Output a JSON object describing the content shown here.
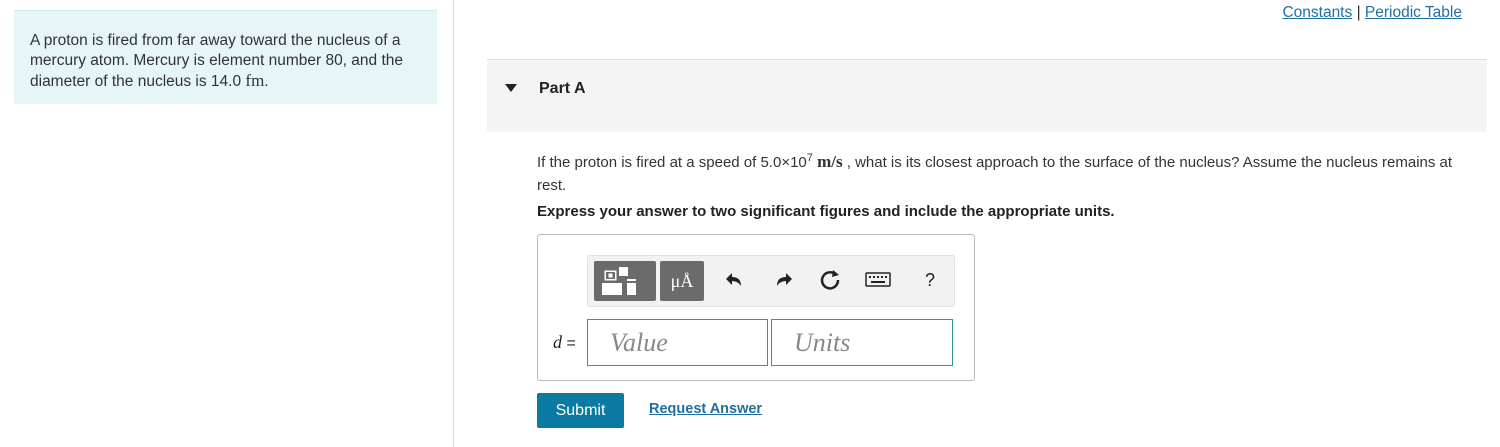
{
  "problem": {
    "text_before": "A proton is fired from far away toward the nucleus of a mercury atom. Mercury is element number 80, and the diameter of the nucleus is 14.0 ",
    "unit": "fm",
    "text_after": "."
  },
  "top_links": {
    "constants": "Constants",
    "separator": "|",
    "periodic_table": "Periodic Table"
  },
  "part": {
    "title": "Part A"
  },
  "question": {
    "prefix": "If the proton is fired at a speed of 5.0×10",
    "exponent": "7",
    "unit": "m/s",
    "suffix": ", what is its closest approach to the surface of the nucleus? Assume the nucleus remains at rest."
  },
  "instruction": "Express your answer to two significant figures and include the appropriate units.",
  "toolbar": {
    "units_label": "μÅ",
    "icons": [
      "templates-icon",
      "units-icon",
      "undo-icon",
      "redo-icon",
      "reset-icon",
      "keyboard-icon",
      "help-icon"
    ],
    "help_label": "?"
  },
  "answer": {
    "variable": "d",
    "equals": "=",
    "value_placeholder": "Value",
    "units_placeholder": "Units"
  },
  "buttons": {
    "submit": "Submit",
    "request_answer": "Request Answer"
  },
  "colors": {
    "accent": "#0a7aa3",
    "link": "#1f6fa3",
    "problem_bg": "#e6f5f7",
    "field_border": "#3a8fa5"
  }
}
